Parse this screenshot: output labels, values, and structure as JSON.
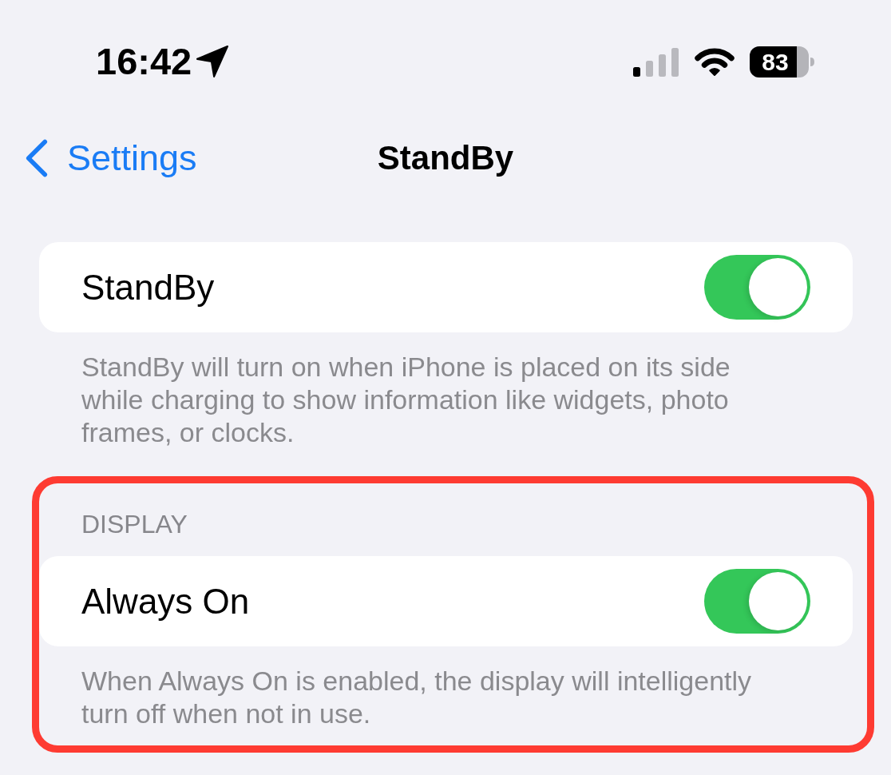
{
  "status_bar": {
    "time": "16:42",
    "battery": "83"
  },
  "nav": {
    "back": "Settings",
    "title": "StandBy"
  },
  "sections": [
    {
      "rows": [
        {
          "label": "StandBy",
          "on": true
        }
      ],
      "footer": "StandBy will turn on when iPhone is placed on its side while charging to show information like widgets, photo frames, or clocks.",
      "highlighted": false
    },
    {
      "header": "DISPLAY",
      "rows": [
        {
          "label": "Always On",
          "on": true
        }
      ],
      "footer": "When Always On is enabled, the display will intelligently turn off when not in use.",
      "highlighted": true
    }
  ]
}
